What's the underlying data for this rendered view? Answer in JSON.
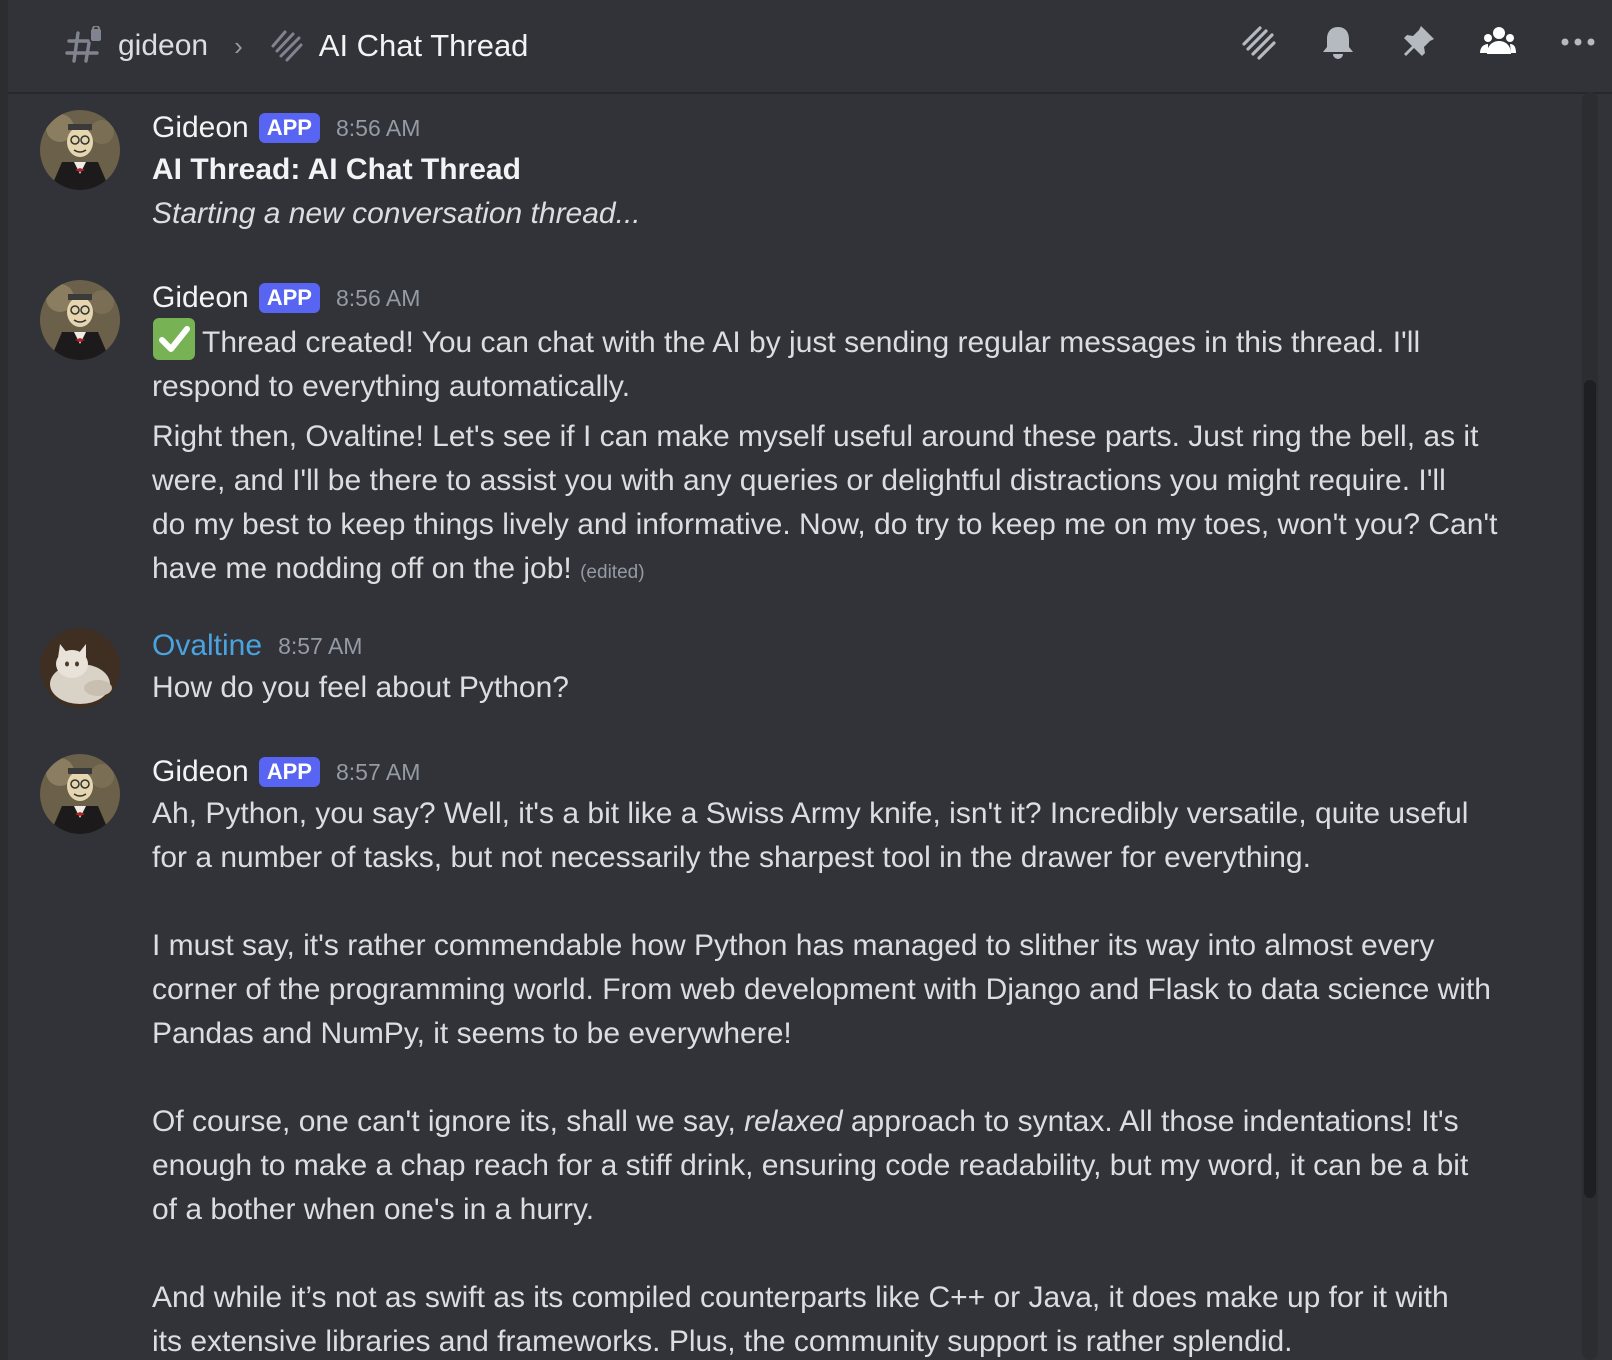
{
  "header": {
    "channel": "gideon",
    "separator": "›",
    "thread_title": "AI Chat Thread",
    "icons": [
      "threads-icon",
      "bell-icon",
      "pin-icon",
      "members-icon",
      "more-icon"
    ]
  },
  "messages": [
    {
      "author": "Gideon",
      "badge": "APP",
      "time": "8:56 AM",
      "title": "AI Thread: AI Chat Thread",
      "subtitle": "Starting a new conversation thread..."
    },
    {
      "author": "Gideon",
      "badge": "APP",
      "time": "8:56 AM",
      "line1": "Thread created! You can chat with the AI by just sending regular messages in this thread. I'll",
      "line2": "respond to everything automatically.",
      "para2": [
        "Right then, Ovaltine! Let's see if I can make myself useful around these parts. Just ring the bell, as it",
        "were, and I'll be there to assist you with any queries or delightful distractions you might require. I'll",
        "do my best to keep things lively and informative. Now, do try to keep me on my toes, won't you? Can't",
        "have me nodding off on the job!"
      ],
      "edited": "(edited)"
    },
    {
      "author": "Ovaltine",
      "time": "8:57 AM",
      "text": "How do you feel about Python?"
    },
    {
      "author": "Gideon",
      "badge": "APP",
      "time": "8:57 AM",
      "p1": [
        "Ah, Python, you say? Well, it's a bit like a Swiss Army knife, isn't it? Incredibly versatile, quite useful",
        "for a number of tasks, but not necessarily the sharpest tool in the drawer for everything."
      ],
      "p2": [
        "I must say, it's rather commendable how Python has managed to slither its way into almost every",
        "corner of the programming world. From web development with Django and Flask to data science with",
        "Pandas and NumPy, it seems to be everywhere!"
      ],
      "p3_pre": "Of course, one can't ignore its, shall we say, ",
      "p3_em": "relaxed",
      "p3_post": " approach to syntax. All those indentations! It's",
      "p3": [
        "enough to make a chap reach for a stiff drink, ensuring code readability, but my word, it can be a bit",
        "of a bother when one's in a hurry."
      ],
      "p4": [
        "And while it’s not as swift as its compiled counterparts like C++ or Java, it does make up for it with",
        "its extensive libraries and frameworks. Plus, the community support is rather splendid."
      ]
    }
  ]
}
